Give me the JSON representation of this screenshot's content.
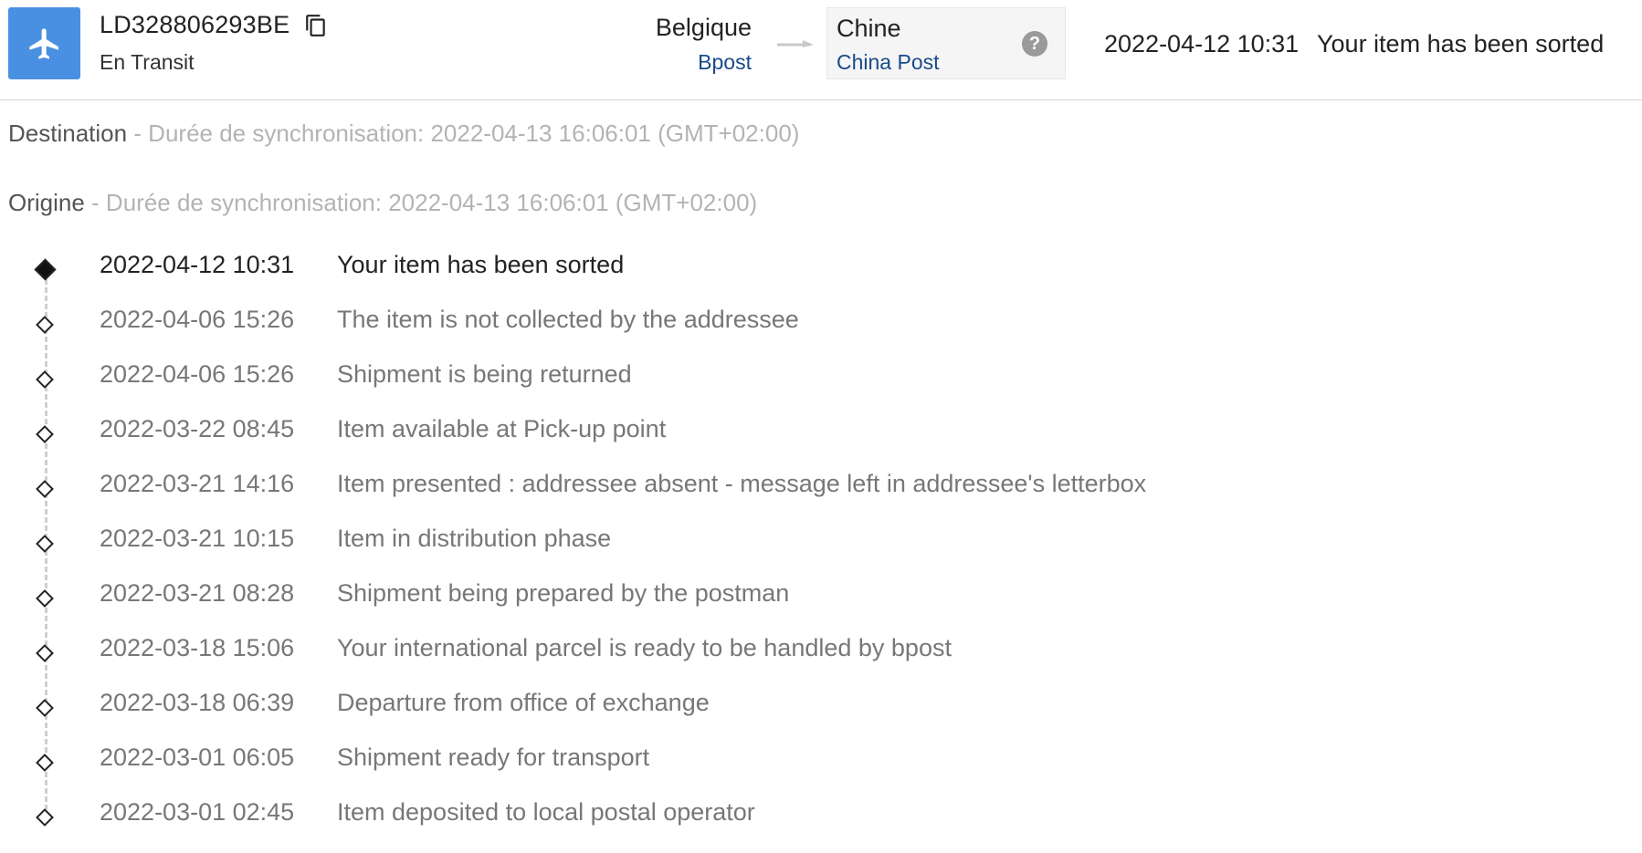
{
  "header": {
    "status_icon": "airplane-icon",
    "tracking_number": "LD328806293BE",
    "status": "En Transit",
    "origin": {
      "country": "Belgique",
      "carrier": "Bpost"
    },
    "destination": {
      "country": "Chine",
      "carrier": "China Post"
    },
    "help_symbol": "?",
    "latest_event": {
      "time": "2022-04-12 10:31",
      "description": "Your item has been sorted"
    }
  },
  "sync": {
    "destination": {
      "label": "Destination",
      "detail": " - Durée de synchronisation: 2022-04-13 16:06:01 (GMT+02:00)"
    },
    "origin": {
      "label": "Origine",
      "detail": " - Durée de synchronisation: 2022-04-13 16:06:01 (GMT+02:00)"
    }
  },
  "events": [
    {
      "time": "2022-04-12 10:31",
      "description": "Your item has been sorted"
    },
    {
      "time": "2022-04-06 15:26",
      "description": "The item is not collected by the addressee"
    },
    {
      "time": "2022-04-06 15:26",
      "description": "Shipment is being returned"
    },
    {
      "time": "2022-03-22 08:45",
      "description": "Item available at Pick-up point"
    },
    {
      "time": "2022-03-21 14:16",
      "description": "Item presented : addressee absent - message left in addressee's letterbox"
    },
    {
      "time": "2022-03-21 10:15",
      "description": "Item in distribution phase"
    },
    {
      "time": "2022-03-21 08:28",
      "description": "Shipment being prepared by the postman"
    },
    {
      "time": "2022-03-18 15:06",
      "description": "Your international parcel is ready to be handled by bpost"
    },
    {
      "time": "2022-03-18 06:39",
      "description": "Departure from office of exchange"
    },
    {
      "time": "2022-03-01 06:05",
      "description": "Shipment ready for transport"
    },
    {
      "time": "2022-03-01 02:45",
      "description": "Item deposited to local postal operator"
    }
  ],
  "colors": {
    "accent": "#4a90e2",
    "carrier_link": "#1a4a8a",
    "muted_text": "#777777"
  }
}
